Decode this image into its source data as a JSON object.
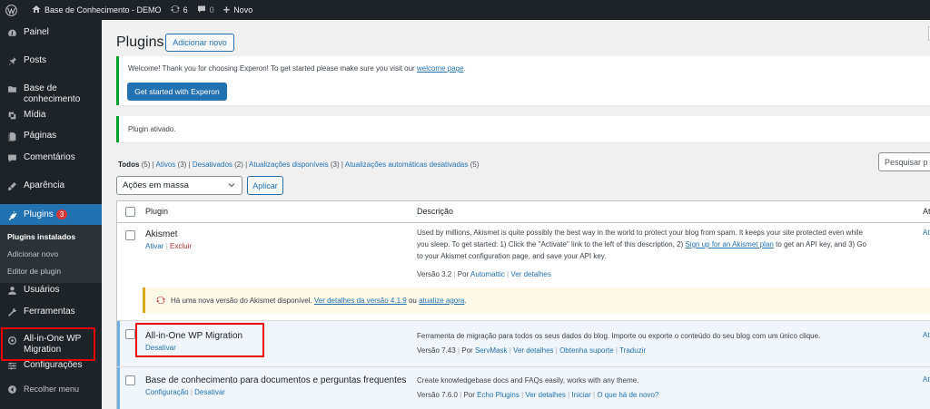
{
  "adminbar": {
    "site_name": "Base de Conhecimento - DEMO",
    "updates_count": "6",
    "comments_count": "0",
    "new_label": "Novo"
  },
  "sidebar": {
    "items": [
      {
        "label": "Painel",
        "icon": "dashboard-icon"
      },
      {
        "label": "Posts",
        "icon": "pin-icon"
      },
      {
        "label": "Base de conhecimento",
        "icon": "knowledge-base-icon"
      },
      {
        "label": "Mídia",
        "icon": "media-icon"
      },
      {
        "label": "Páginas",
        "icon": "pages-icon"
      },
      {
        "label": "Comentários",
        "icon": "comments-icon"
      },
      {
        "label": "Aparência",
        "icon": "appearance-icon"
      },
      {
        "label": "Plugins",
        "icon": "plugins-icon",
        "badge": "3"
      },
      {
        "label": "Usuários",
        "icon": "users-icon"
      },
      {
        "label": "Ferramentas",
        "icon": "tools-icon"
      },
      {
        "label": "All-in-One WP Migration",
        "icon": "migration-icon"
      },
      {
        "label": "Configurações",
        "icon": "settings-icon"
      },
      {
        "label": "Recolher menu",
        "icon": "collapse-icon"
      }
    ],
    "submenu": [
      "Plugins instalados",
      "Adicionar novo",
      "Editor de plugin"
    ]
  },
  "page": {
    "title": "Plugins",
    "add_new": "Adicionar novo"
  },
  "notice_welcome": {
    "text": "Welcome! Thank you for choosing Experon! To get started please make sure you visit our",
    "link": "welcome page",
    "end": ".",
    "button": "Get started with Experon"
  },
  "notice_activated": {
    "text": "Plugin ativado."
  },
  "views": {
    "all": "Todos",
    "all_count": "(5)",
    "active": "Ativos",
    "active_count": "(3)",
    "inactive": "Desativados",
    "inactive_count": "(2)",
    "updates": "Atualizações disponíveis",
    "updates_count": "(3)",
    "auto_off": "Atualizações automáticas desativadas",
    "auto_off_count": "(5)",
    "sep": "|"
  },
  "bulk": {
    "selected": "Ações em massa",
    "apply": "Aplicar"
  },
  "search": {
    "placeholder": "Pesquisar p"
  },
  "table": {
    "col_plugin": "Plugin",
    "col_desc": "Descrição",
    "col_auto_cut": "At",
    "plugins": [
      {
        "name": "Akismet",
        "actions": [
          "Ativar",
          "Excluir"
        ],
        "desc_l1": "Used by millions, Akismet is quite possibly the best way in the world to protect your blog from spam. It keeps your site protected even while",
        "desc_l2_pre": "you sleep. To get started: 1) Click the \"Activate\" link to the left of this description, 2)",
        "desc_l2_link": "Sign up for an Akismet plan",
        "desc_l2_post": "to get an API key, and 3) Go",
        "desc_l3": "to your Akismet configuration page, and save your API key.",
        "version": "Versão 3.2",
        "by": "Por",
        "author": "Automattic",
        "details": "Ver detalhes",
        "auto": "At",
        "update_pre": "Há uma nova versão do Akismet disponível.",
        "update_link1": "Ver detalhes da versão 4.1.9",
        "update_mid": "ou",
        "update_link2": "atualize agora",
        "update_end": "."
      },
      {
        "name": "All-in-One WP Migration",
        "actions": [
          "Desativar"
        ],
        "desc_l1": "Ferramenta de migração para todos os seus dados do blog. Importe ou exporte o conteúdo do seu blog com um único clique.",
        "version": "Versão 7.43",
        "by": "Por",
        "author": "ServMask",
        "links": [
          "Ver detalhes",
          "Obtenha suporte",
          "Traduzir"
        ],
        "auto": "At"
      },
      {
        "name": "Base de conhecimento para documentos e perguntas frequentes",
        "actions": [
          "Configuração",
          "Desativar"
        ],
        "desc_l1": "Create knowledgebase docs and FAQs easily, works with any theme.",
        "version": "Versão 7.6.0",
        "by": "Por",
        "author": "Echo Plugins",
        "links": [
          "Ver detalhes",
          "Iniciar",
          "O que há de novo?"
        ],
        "auto": "At"
      }
    ]
  },
  "colors": {
    "adminbar_bg": "#1d2327",
    "accent": "#2271b1",
    "success": "#00a32a",
    "warning": "#dba617",
    "highlight_box": "#e00000"
  }
}
